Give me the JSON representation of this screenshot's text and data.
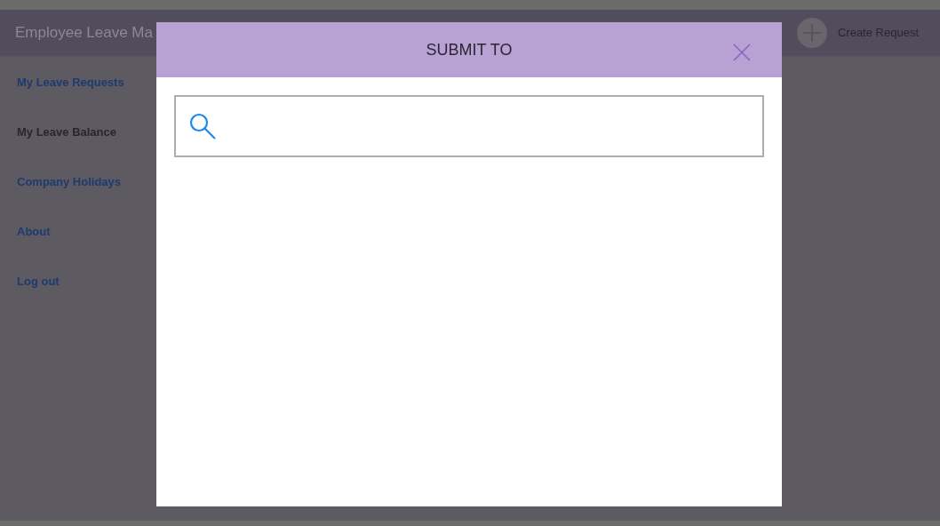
{
  "app": {
    "title": "Employee Leave Ma",
    "create_button": "Create Request"
  },
  "sidebar": {
    "items": [
      {
        "label": "My Leave Requests",
        "selected": false
      },
      {
        "label": "My Leave Balance",
        "selected": true
      },
      {
        "label": "Company Holidays",
        "selected": false
      },
      {
        "label": "About",
        "selected": false
      },
      {
        "label": "Log out",
        "selected": false
      }
    ]
  },
  "dialog": {
    "title": "SUBMIT TO"
  }
}
